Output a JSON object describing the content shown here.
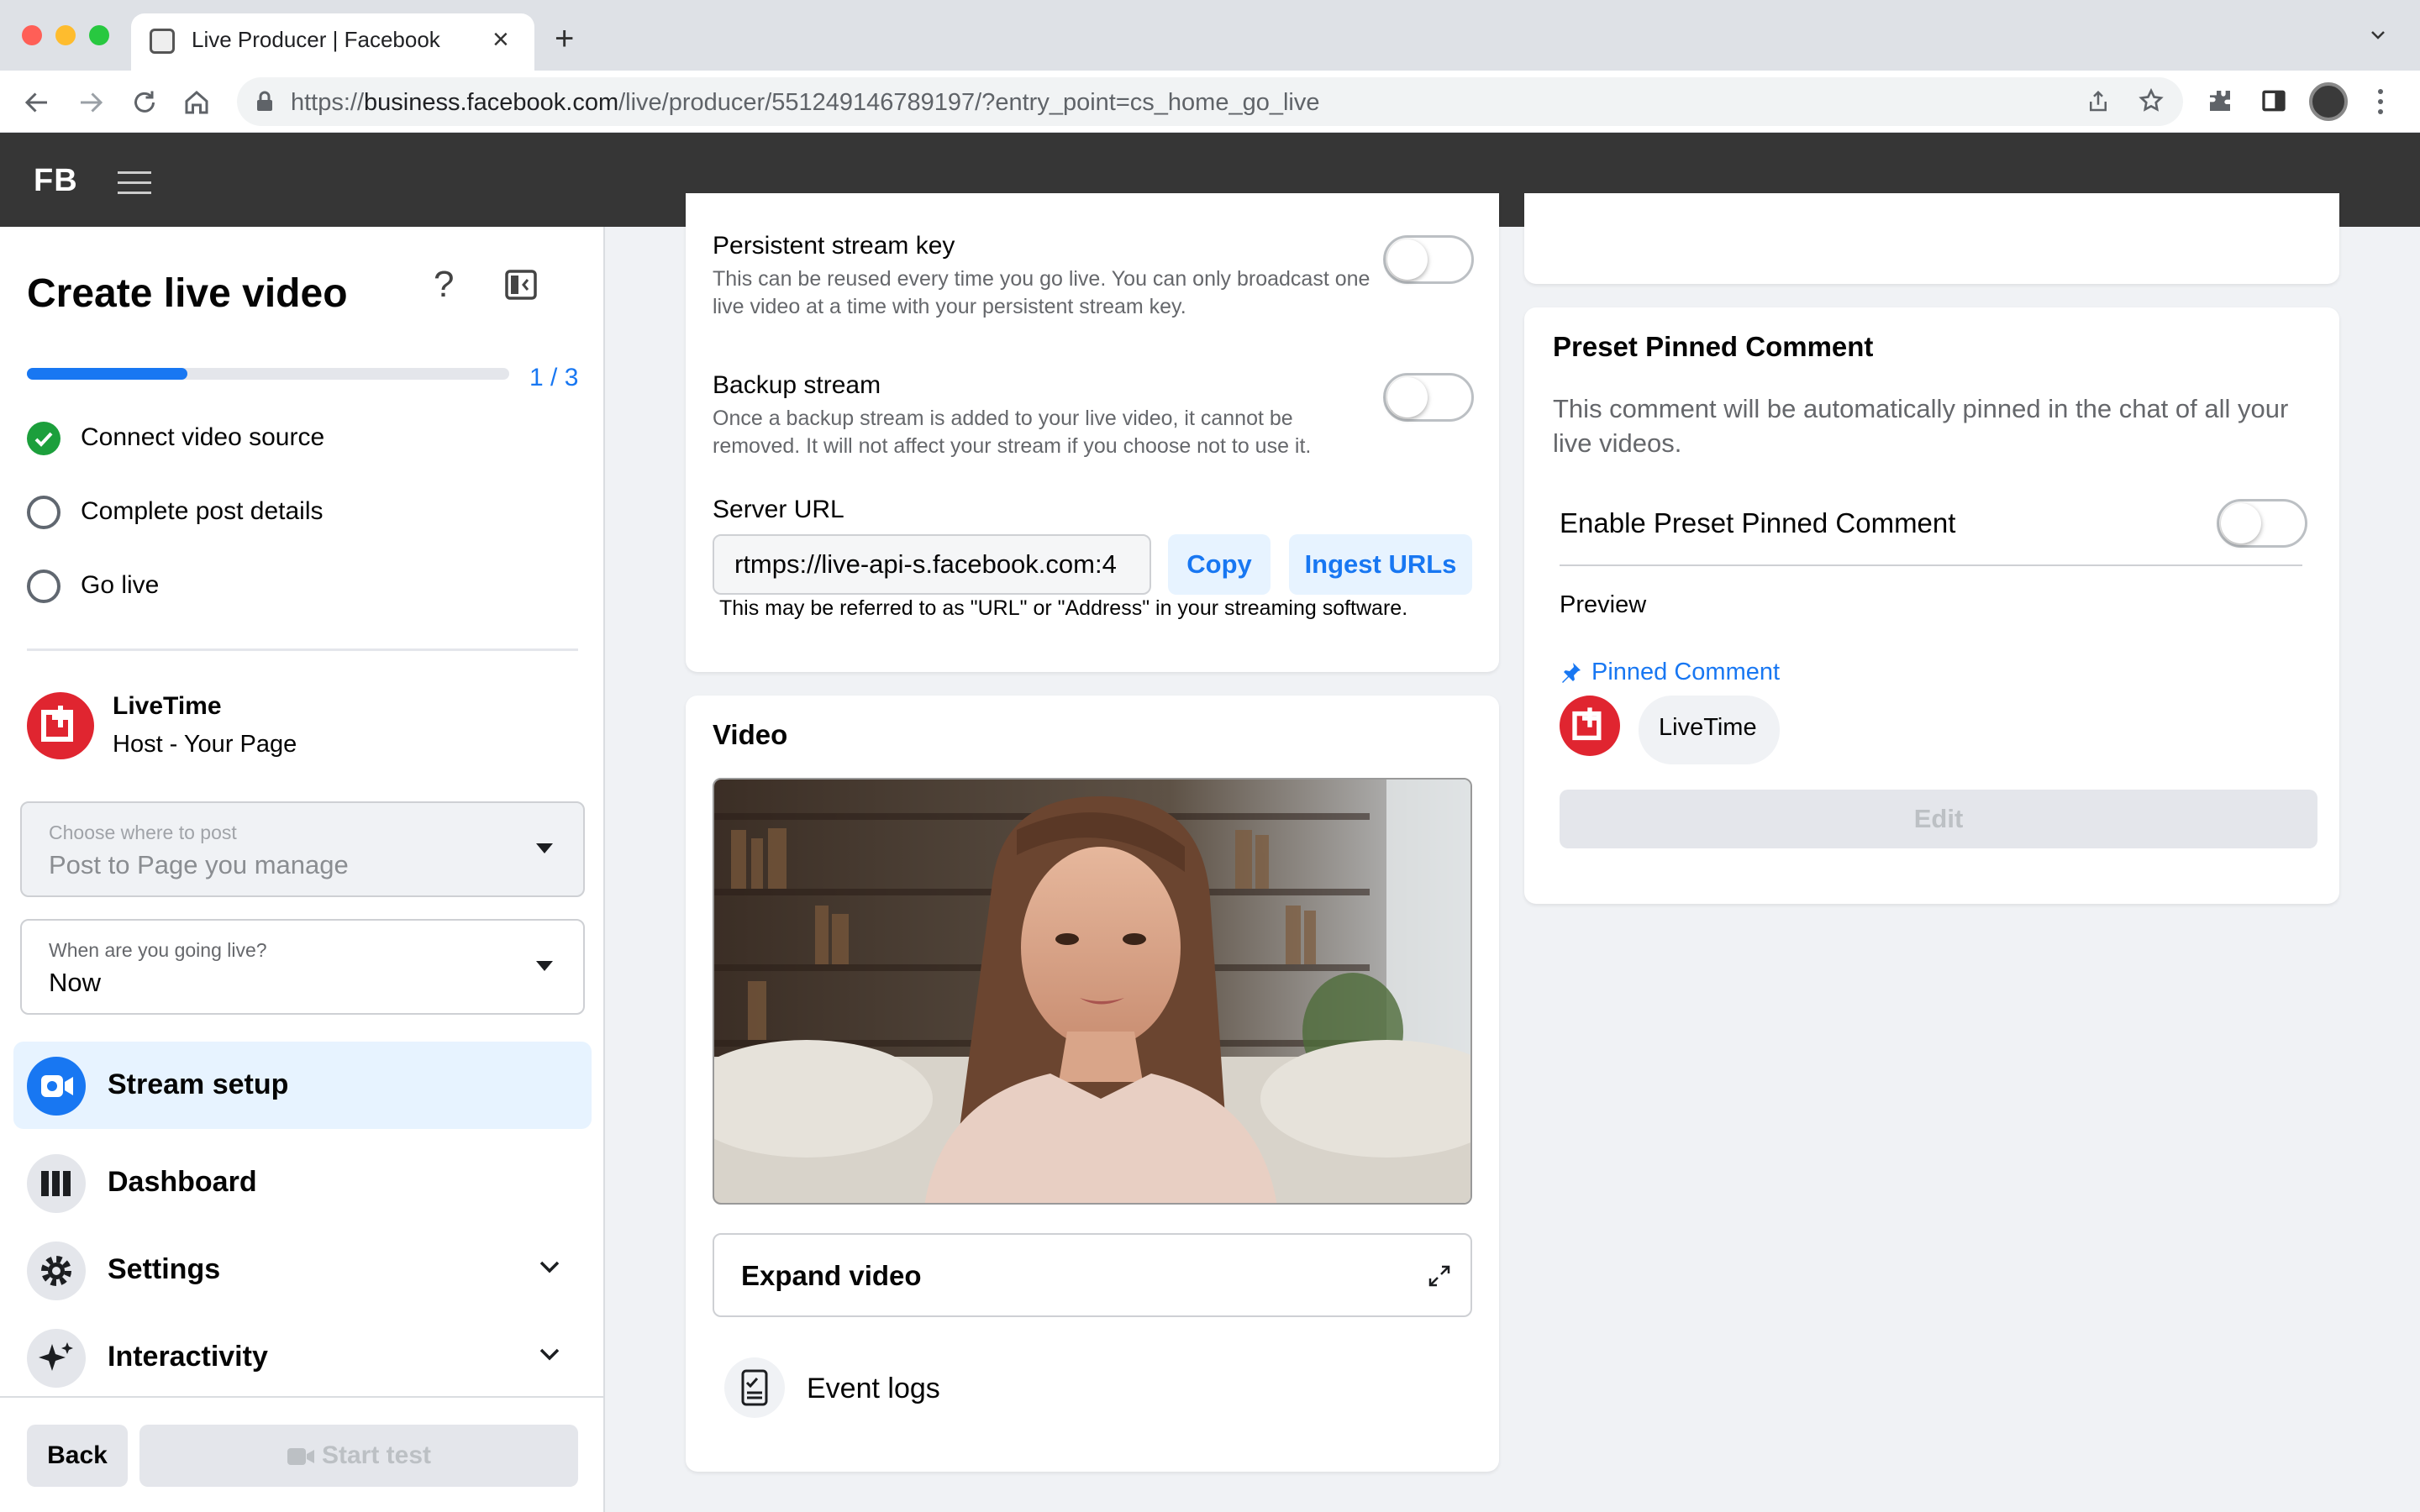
{
  "browser": {
    "tab_title": "Live Producer | Facebook",
    "url_scheme": "https://",
    "url_host": "business.facebook.com",
    "url_path": "/live/producer/551249146789197/?entry_point=cs_home_go_live"
  },
  "header": {
    "logo": "FB"
  },
  "sidebar": {
    "title": "Create live video",
    "progress": {
      "fraction": 0.333,
      "label": "1 / 3"
    },
    "steps": [
      {
        "label": "Connect video source",
        "done": true
      },
      {
        "label": "Complete post details",
        "done": false
      },
      {
        "label": "Go live",
        "done": false
      }
    ],
    "host": {
      "name": "LiveTime",
      "role": "Host - Your Page"
    },
    "post_select": {
      "label": "Choose where to post",
      "value": "Post to Page you manage"
    },
    "when_select": {
      "label": "When are you going live?",
      "value": "Now"
    },
    "nav": [
      {
        "label": "Stream setup",
        "icon": "camera-icon",
        "active": true
      },
      {
        "label": "Dashboard",
        "icon": "bars-icon"
      },
      {
        "label": "Settings",
        "icon": "gear-icon"
      },
      {
        "label": "Interactivity",
        "icon": "sparkle-icon"
      }
    ],
    "back_label": "Back",
    "start_label": "Start test"
  },
  "stream_setup": {
    "persistent": {
      "title": "Persistent stream key",
      "desc": "This can be reused every time you go live. You can only broadcast one live video at a time with your persistent stream key.",
      "enabled": false
    },
    "backup": {
      "title": "Backup stream",
      "desc": "Once a backup stream is added to your live video, it cannot be removed. It will not affect your stream if you choose not to use it.",
      "enabled": false
    },
    "server_url": {
      "label": "Server URL",
      "value": "rtmps://live-api-s.facebook.com:4",
      "copy_label": "Copy",
      "ingest_label": "Ingest URLs",
      "hint": "This may be referred to as \"URL\" or \"Address\" in your streaming software."
    }
  },
  "video": {
    "title": "Video",
    "expand_label": "Expand video",
    "event_logs_label": "Event logs"
  },
  "pinned": {
    "title": "Preset Pinned Comment",
    "desc": "This comment will be automatically pinned in the chat of all your live videos.",
    "enable_label": "Enable Preset Pinned Comment",
    "enabled": false,
    "preview_label": "Preview",
    "pinned_label": "Pinned Comment",
    "author": "LiveTime",
    "edit_label": "Edit"
  },
  "colors": {
    "accent": "#1877f2",
    "success": "#1c9f3c",
    "brand": "#e02530",
    "header": "#363636"
  }
}
